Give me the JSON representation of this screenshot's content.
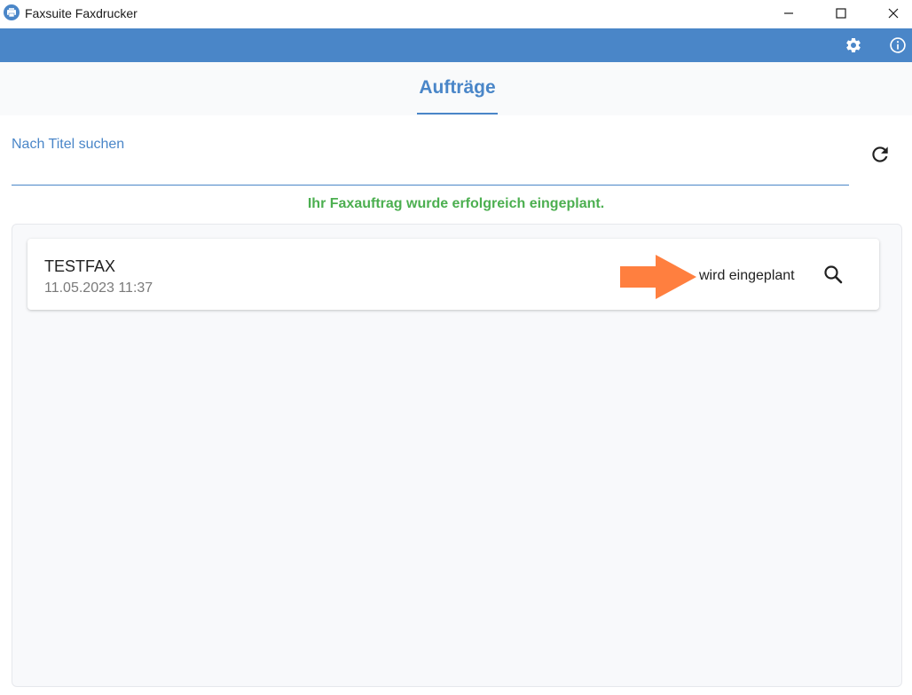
{
  "window": {
    "title": "Faxsuite Faxdrucker",
    "icons": {
      "app": "fax-app-icon",
      "minimize": "minimize-icon",
      "maximize": "maximize-icon",
      "close": "close-icon"
    }
  },
  "appbar": {
    "color": "#4a86c8",
    "icons": {
      "settings": "gear-icon",
      "info": "info-icon"
    }
  },
  "tabs": [
    {
      "label": "Aufträge",
      "active": true
    }
  ],
  "search": {
    "label": "Nach Titel suchen",
    "value": "",
    "icons": {
      "refresh": "refresh-icon"
    }
  },
  "status_message": {
    "text": "Ihr Faxauftrag wurde erfolgreich eingeplant.",
    "color": "#4caf50"
  },
  "jobs": [
    {
      "title": "TESTFAX",
      "date": "11.05.2023 11:37",
      "status": "wird eingeplant",
      "annotation": {
        "icon": "arrow-right-icon",
        "color": "#ff7f3f"
      },
      "icons": {
        "view": "search-icon"
      }
    }
  ]
}
